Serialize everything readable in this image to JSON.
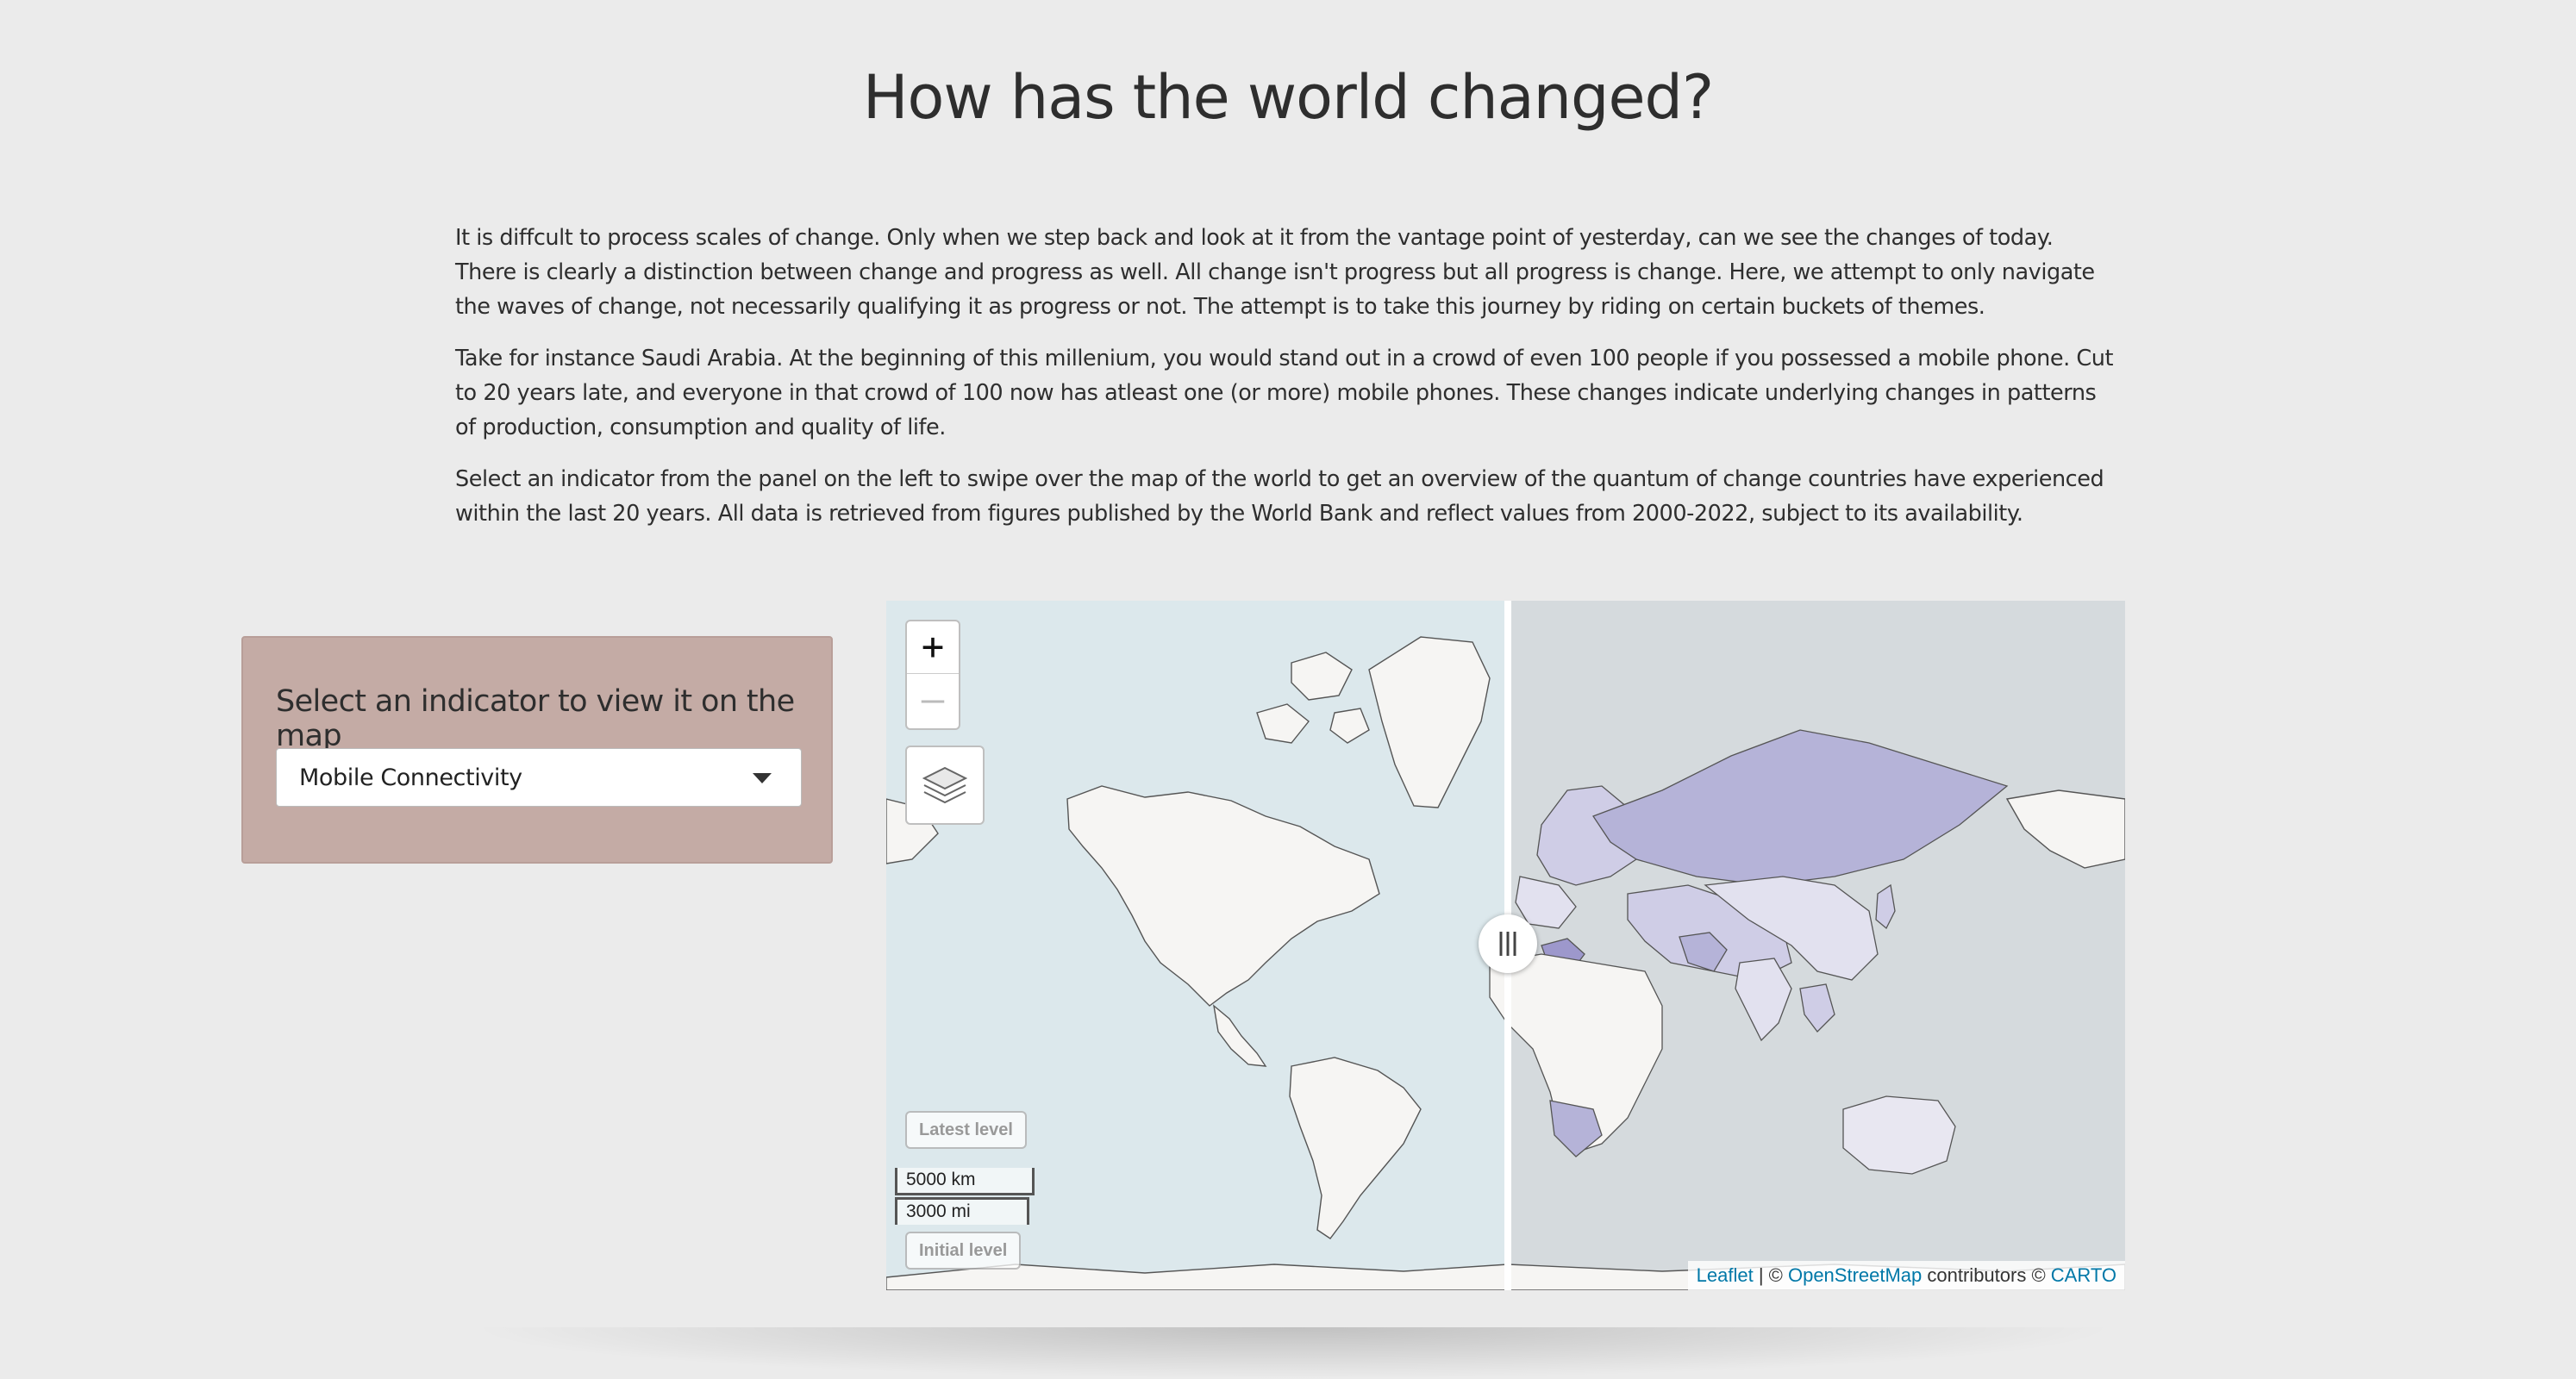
{
  "page": {
    "title": "How has the world changed?",
    "paragraphs": [
      "It is diffcult to process scales of change. Only when we step back and look at it from the vantage point of yesterday, can we see the changes of today. There is clearly a distinction between change and progress as well. All change isn't progress but all progress is change. Here, we attempt to only navigate the waves of change, not necessarily qualifying it as progress or not. The attempt is to take this journey by riding on certain buckets of themes.",
      "Take for instance Saudi Arabia. At the beginning of this millenium, you would stand out in a crowd of even 100 people if you possessed a mobile phone. Cut to 20 years late, and everyone in that crowd of 100 now has atleast one (or more) mobile phones. These changes indicate underlying changes in patterns of production, consumption and quality of life.",
      "Select an indicator from the panel on the left to swipe over the map of the world to get an overview of the quantum of change countries have experienced within the last 20 years. All data is retrieved from figures published by the World Bank and reflect values from 2000-2022, subject to its availability."
    ]
  },
  "panel": {
    "heading": "Select an indicator to view it on the map",
    "selected_indicator": "Mobile Connectivity"
  },
  "map": {
    "zoom_in": "+",
    "zoom_out": "—",
    "latest_level": "Latest level",
    "initial_level": "Initial level",
    "scale_km": "5000 km",
    "scale_mi": "3000 mi",
    "attribution": {
      "leaflet": "Leaflet",
      "sep": " | © ",
      "osm": "OpenStreetMap",
      "contributors": " contributors © ",
      "carto": "CARTO"
    },
    "colors": {
      "ocean_left": "#dce8ec",
      "ocean_right": "#d5dadd",
      "land_light": "#f6f5f3",
      "choropleth_high": "#b5b3d8",
      "choropleth_mid": "#cfcde6",
      "choropleth_top": "#9d98cc"
    }
  }
}
